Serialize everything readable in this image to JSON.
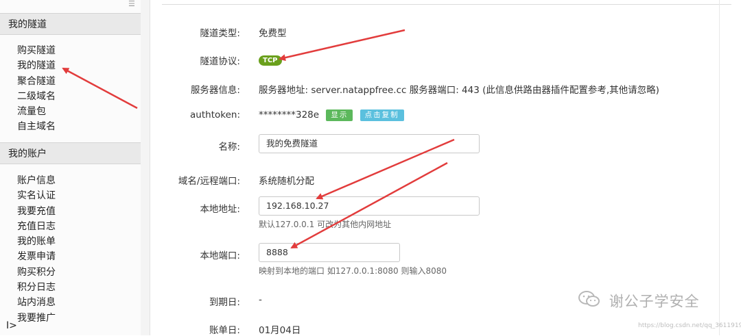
{
  "sidebar": {
    "section1_title": "我的隧道",
    "section1_items": [
      "购买隧道",
      "我的隧道",
      "聚合隧道",
      "二级域名",
      "流量包",
      "自主域名"
    ],
    "section2_title": "我的账户",
    "section2_items": [
      "账户信息",
      "实名认证",
      "我要充值",
      "充值日志",
      "我的账单",
      "发票申请",
      "购买积分",
      "积分日志",
      "站内消息",
      "我要推广"
    ],
    "bottom_icon": "I>"
  },
  "form": {
    "type_label": "隧道类型:",
    "type_value": "免费型",
    "protocol_label": "隧道协议:",
    "protocol_value": "TCP",
    "server_label": "服务器信息:",
    "server_value": "服务器地址: server.natappfree.cc 服务器端口: 443 (此信息供路由器插件配置参考,其他请忽略)",
    "authtoken_label": "authtoken:",
    "authtoken_value": "********328e",
    "show_button": "显示",
    "copy_button": "点击复制",
    "name_label": "名称:",
    "name_value": "我的免费隧道",
    "domain_label": "域名/远程端口:",
    "domain_value": "系统随机分配",
    "local_addr_label": "本地地址:",
    "local_addr_value": "192.168.10.27",
    "local_addr_help": "默认127.0.0.1 可改为其他内网地址",
    "local_port_label": "本地端口:",
    "local_port_value": "8888",
    "local_port_help": "映射到本地的端口 如127.0.0.1:8080 则输入8080",
    "expire_label": "到期日:",
    "expire_value": "-",
    "bill_label": "账单日:",
    "bill_value": "01月04日"
  },
  "watermark": {
    "text": "谢公子学安全",
    "url": "https://blog.csdn.net/qq_36119192"
  },
  "colors": {
    "arrow": "#e23c3c",
    "tcp_badge": "#6aa01c",
    "show_button": "#5cb85c",
    "copy_button": "#5bc0de"
  }
}
